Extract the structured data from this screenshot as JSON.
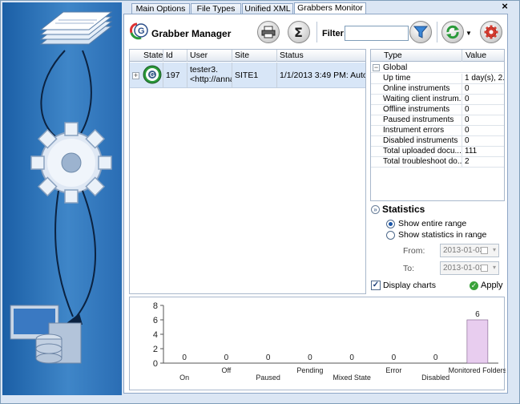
{
  "tabs": [
    {
      "label": "Main Options",
      "active": false
    },
    {
      "label": "File Types",
      "active": false
    },
    {
      "label": "Unified XML",
      "active": false
    },
    {
      "label": "Grabbers Monitor",
      "active": true
    }
  ],
  "close_label": "×",
  "toolbar": {
    "title": "Grabber Manager",
    "filter_label": "Filter:",
    "filter_value": ""
  },
  "grid": {
    "columns": [
      "State",
      "Id",
      "User",
      "Site",
      "Status"
    ],
    "rows": [
      {
        "expander": "+",
        "id": "197",
        "user_line1": "tester3.",
        "user_line2": "<http://anna",
        "site": "SITE1",
        "status": "1/1/2013  3:49  PM:  Auto..."
      }
    ]
  },
  "properties": {
    "columns": [
      "Type",
      "Value"
    ],
    "group": {
      "expander": "−",
      "label": "Global"
    },
    "rows": [
      {
        "key": "Up time",
        "value": "1 day(s), 2..."
      },
      {
        "key": "Online instruments",
        "value": "0"
      },
      {
        "key": "Waiting client instrum...",
        "value": "0"
      },
      {
        "key": "Offline instruments",
        "value": "0"
      },
      {
        "key": "Paused instruments",
        "value": "0"
      },
      {
        "key": "Instrument errors",
        "value": "0"
      },
      {
        "key": "Disabled instruments",
        "value": "0"
      },
      {
        "key": "Total uploaded docu...",
        "value": "111"
      },
      {
        "key": "Total troubleshoot do...",
        "value": "2"
      }
    ]
  },
  "statistics": {
    "chevron": "»",
    "title": "Statistics",
    "option_entire": "Show entire range",
    "option_range": "Show statistics in range",
    "selected": "entire",
    "from_label": "From:",
    "from_value": "2013-01-03",
    "to_label": "To:",
    "to_value": "2013-01-03",
    "dropdown_glyph": "▾",
    "display_charts_label": "Display charts",
    "display_charts_checked": true,
    "checkmark": "✓",
    "apply_label": "Apply",
    "apply_icon": "✓"
  },
  "colors": {
    "bar_fill": "#e8cdef",
    "bar_stroke": "#7a5a86",
    "accent_blue": "#1b5fa6"
  },
  "chart_data": {
    "type": "bar",
    "categories": [
      "On",
      "Off",
      "Paused",
      "Pending",
      "Mixed State",
      "Error",
      "Disabled",
      "Monitored Folders"
    ],
    "values": [
      0,
      0,
      0,
      0,
      0,
      0,
      0,
      6
    ],
    "data_labels": [
      "0",
      "0",
      "0",
      "0",
      "0",
      "0",
      "0",
      "6"
    ],
    "ylim": [
      0,
      8
    ],
    "yticks": [
      0,
      2,
      4,
      6,
      8
    ],
    "grid": false,
    "legend": "none"
  }
}
